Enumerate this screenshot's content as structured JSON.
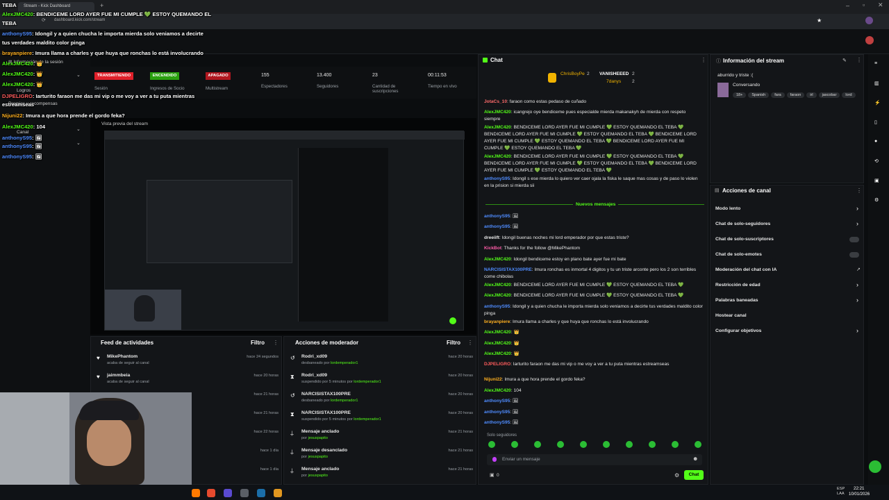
{
  "window": {
    "tab_title": "Stream - Kick Dashboard",
    "url": "dashboard.kick.com/stream"
  },
  "stats": {
    "status1": "TRANSMITIENDO",
    "status2": "ENCENDIDO",
    "status3": "APAGADO",
    "label1": "Sesión",
    "label2": "Ingresos de Socio",
    "label3": "Multistream",
    "viewers": "155",
    "viewers_label": "Espectadores",
    "followers": "13.400",
    "followers_label": "Seguidores",
    "subs": "23",
    "subs_label": "Cantidad de suscripciones",
    "time": "00:11:53",
    "time_label": "Tiempo en vivo"
  },
  "sidebar": {
    "info": "Información de la sesión",
    "rewards": "Premios y recompensas",
    "logros": "Logros",
    "canal": "Canal"
  },
  "preview": {
    "title": "Vista previa del stream"
  },
  "overlay": {
    "lines": [
      {
        "u": "TEBA",
        "t": ""
      },
      {
        "u": "AlexJMC420",
        "t": ": BENDICEME LORD AYER FUE MI CUMPLE 💚 ESTOY QUEMANDO EL"
      },
      {
        "u": "TEBA",
        "t": ""
      },
      {
        "u": "anthonyS95",
        "t": ": Idongil y a quien chucha le importa mierda solo veniamos a decirte"
      },
      {
        "u": "",
        "t": "tus verdades maldito color pinga"
      },
      {
        "u": "brayanpiere",
        "t": ": Imura llama a charles y que huya que ronchas lo está involucrando"
      },
      {
        "u": "AlexJMC420",
        "t": ": 👑"
      },
      {
        "u": "AlexJMC420",
        "t": ": 👑"
      },
      {
        "u": "AlexJMC420",
        "t": ": 👑"
      },
      {
        "u": "DJPELIGRO",
        "t": ": Iarturito faraon me das mi vip o me voy a ver a tu puta mientras"
      },
      {
        "u": "",
        "t": "estreamseas"
      },
      {
        "u": "Nijuni22",
        "t": ": Imura a que hora prende el gordo feka?"
      },
      {
        "u": "AlexJMC420",
        "t": ": 104"
      },
      {
        "u": "anthonyS95",
        "t": ": 🖼"
      },
      {
        "u": "anthonyS95",
        "t": ": 🖼"
      },
      {
        "u": "anthonyS95",
        "t": ": 🖼"
      }
    ]
  },
  "activity": {
    "title": "Feed de actividades",
    "filter": "Filtro",
    "items": [
      {
        "name": "MikePhantom",
        "sub": "acaba de seguir al canal",
        "time": "hace 24 segundos"
      },
      {
        "name": "jaimmbeia",
        "sub": "acaba de seguir al canal",
        "time": "hace 20 horas"
      },
      {
        "name": "",
        "sub": "",
        "time": "hace 21 horas"
      },
      {
        "name": "",
        "sub": "",
        "time": "hace 21 horas"
      },
      {
        "name": "",
        "sub": "",
        "time": "hace 22 horas"
      },
      {
        "name": "",
        "sub": "",
        "time": "hace 1 día"
      },
      {
        "name": "",
        "sub": "",
        "time": "hace 1 día"
      }
    ]
  },
  "modactions": {
    "title": "Acciones de moderador",
    "filter": "Filtro",
    "items": [
      {
        "name": "Rodri_xd09",
        "sub": "desbaneado por",
        "by": "lordemperador1",
        "time": "hace 20 horas"
      },
      {
        "name": "Rodri_xd09",
        "sub": "suspendido por 5 minutos por",
        "by": "lordemperador1",
        "time": "hace 20 horas"
      },
      {
        "name": "NARCISISTAX100PRE",
        "sub": "desbaneado por",
        "by": "lordemperador1",
        "time": "hace 20 horas"
      },
      {
        "name": "NARCISISTAX100PRE",
        "sub": "suspendido por 5 minutos por",
        "by": "lordemperador1",
        "time": "hace 20 horas"
      },
      {
        "name": "Mensaje anclado",
        "sub": "por",
        "by": "jesuspapito",
        "time": "hace 21 horas"
      },
      {
        "name": "Mensaje desanclado",
        "sub": "por",
        "by": "jesuspapito",
        "time": "hace 21 horas"
      },
      {
        "name": "Mensaje anclado",
        "sub": "por",
        "by": "jesuspapito",
        "time": "hace 21 horas"
      }
    ]
  },
  "chat": {
    "title": "Chat",
    "pinned1": "ChrisBoyPe",
    "pinned1_n": "2",
    "pinned2": "VANISHEEED",
    "pinned2_n": "2",
    "pinned3": "7danys",
    "pinned3_n": "2",
    "new_messages": "Nuevos mensajes",
    "messages": [
      {
        "u": "JotaCs_10",
        "c": "#ff6b6b",
        "t": ": faraon como estas pedaso de cuñado"
      },
      {
        "u": "AlexJMC420",
        "c": "#53fc18",
        "t": ": icangrejo oye bendiceme pues especialde mierda makanakyh de mierda con respeto siempre"
      },
      {
        "u": "AlexJMC420",
        "c": "#53fc18",
        "t": ": BENDICEME LORD AYER FUE MI CUMPLE 💚 ESTOY QUEMANDO EL TEBA 💚 BENDICEME LORD AYER FUE MI CUMPLE 💚 ESTOY QUEMANDO EL TEBA 💚 BENDICEME LORD AYER FUE MI CUMPLE 💚 ESTOY QUEMANDO EL TEBA 💚 BENDICEME LORD AYER FUE MI CUMPLE 💚 ESTOY QUEMANDO EL TEBA 💚"
      },
      {
        "u": "AlexJMC420",
        "c": "#53fc18",
        "t": ": BENDICEME LORD AYER FUE MI CUMPLE 💚 ESTOY QUEMANDO EL TEBA 💚 BENDICEME LORD AYER FUE MI CUMPLE 💚 ESTOY QUEMANDO EL TEBA 💚 BENDICEME LORD AYER FUE MI CUMPLE 💚 ESTOY QUEMANDO EL TEBA 💚"
      },
      {
        "u": "anthonyS95",
        "c": "#4f8cff",
        "t": ": Idongil s ese mierda lo quiero ver caer ojala la fiska le saque mas cosas y de paso lo violen en la prision si mierda sii"
      }
    ],
    "new": [
      {
        "u": "anthonyS95",
        "c": "#4f8cff",
        "t": ": 🖼"
      },
      {
        "u": "anthonyS95",
        "c": "#4f8cff",
        "t": ": 🖼"
      },
      {
        "u": "dreeiift",
        "c": "#e8e8e8",
        "t": ": Idongil buenas noches mi lord emperador por que estas triste?"
      },
      {
        "u": "KickBot",
        "c": "#ff5ca8",
        "t": ": Thanks for the follow @MikePhantom"
      },
      {
        "u": "AlexJMC420",
        "c": "#53fc18",
        "t": ": Idongil bendiceme estoy en plano bate ayer fue mi bate"
      },
      {
        "u": "NARCISISTAX100PRE",
        "c": "#4f8cff",
        "t": ": Imura ronchas es inmortal 4 digitos y tu un triste arconte pero los 2 son terribles come chibolas"
      },
      {
        "u": "AlexJMC420",
        "c": "#53fc18",
        "t": ": BENDICEME LORD AYER FUE MI CUMPLE 💚 ESTOY QUEMANDO EL TEBA 💚"
      },
      {
        "u": "AlexJMC420",
        "c": "#53fc18",
        "t": ": BENDICEME LORD AYER FUE MI CUMPLE 💚 ESTOY QUEMANDO EL TEBA 💚"
      },
      {
        "u": "anthonyS95",
        "c": "#4f8cff",
        "t": ": Idongil y a quien chucha le importa mierda solo veniamos a decirte tus verdades maldito color pinga"
      },
      {
        "u": "brayanpiere",
        "c": "#ffb020",
        "t": ": Imura llama a charles y que huya que ronchas lo está involucrando"
      },
      {
        "u": "AlexJMC420",
        "c": "#53fc18",
        "t": ": 👑"
      },
      {
        "u": "AlexJMC420",
        "c": "#53fc18",
        "t": ": 👑"
      },
      {
        "u": "AlexJMC420",
        "c": "#53fc18",
        "t": ": 👑"
      },
      {
        "u": "DJPELIGRO",
        "c": "#ff5c5c",
        "t": ": Iarturito faraon me das mi vip o me voy a ver a tu puta mientras estreamseas"
      },
      {
        "u": "Nijuni22",
        "c": "#ffb020",
        "t": ": Imura a que hora prende el gordo feka?"
      },
      {
        "u": "AlexJMC420",
        "c": "#53fc18",
        "t": ": 104"
      },
      {
        "u": "anthonyS95",
        "c": "#4f8cff",
        "t": ": 🖼"
      },
      {
        "u": "anthonyS95",
        "c": "#4f8cff",
        "t": ": 🖼"
      },
      {
        "u": "anthonyS95",
        "c": "#4f8cff",
        "t": ": 🖼"
      }
    ],
    "solo": "Solo seguidores",
    "placeholder": "Enviar un mensaje",
    "send": "Chat",
    "count": "0"
  },
  "streaminfo": {
    "title": "Información del stream",
    "stream_title": "aburrido y triste :(",
    "category": "Conversando",
    "tags": [
      "18+",
      "Spanish",
      "fara",
      "faraon",
      "irl",
      "jascobar",
      "lord"
    ]
  },
  "channel": {
    "title": "Acciones de canal",
    "items": [
      "Modo lento",
      "Chat de solo-seguidores",
      "Chat de solo-suscriptores",
      "Chat de solo-emotes",
      "Moderación del chat con IA",
      "Restricción de edad",
      "Palabras baneadas",
      "Hostear canal",
      "Configurar objetivos"
    ]
  },
  "clock": {
    "time": "22:21",
    "date": "10/01/2026",
    "lang": "ESP\nLAA"
  },
  "colors": {
    "accent": "#53fc18",
    "bg": "#0b0d0f",
    "panel": "#131518"
  }
}
